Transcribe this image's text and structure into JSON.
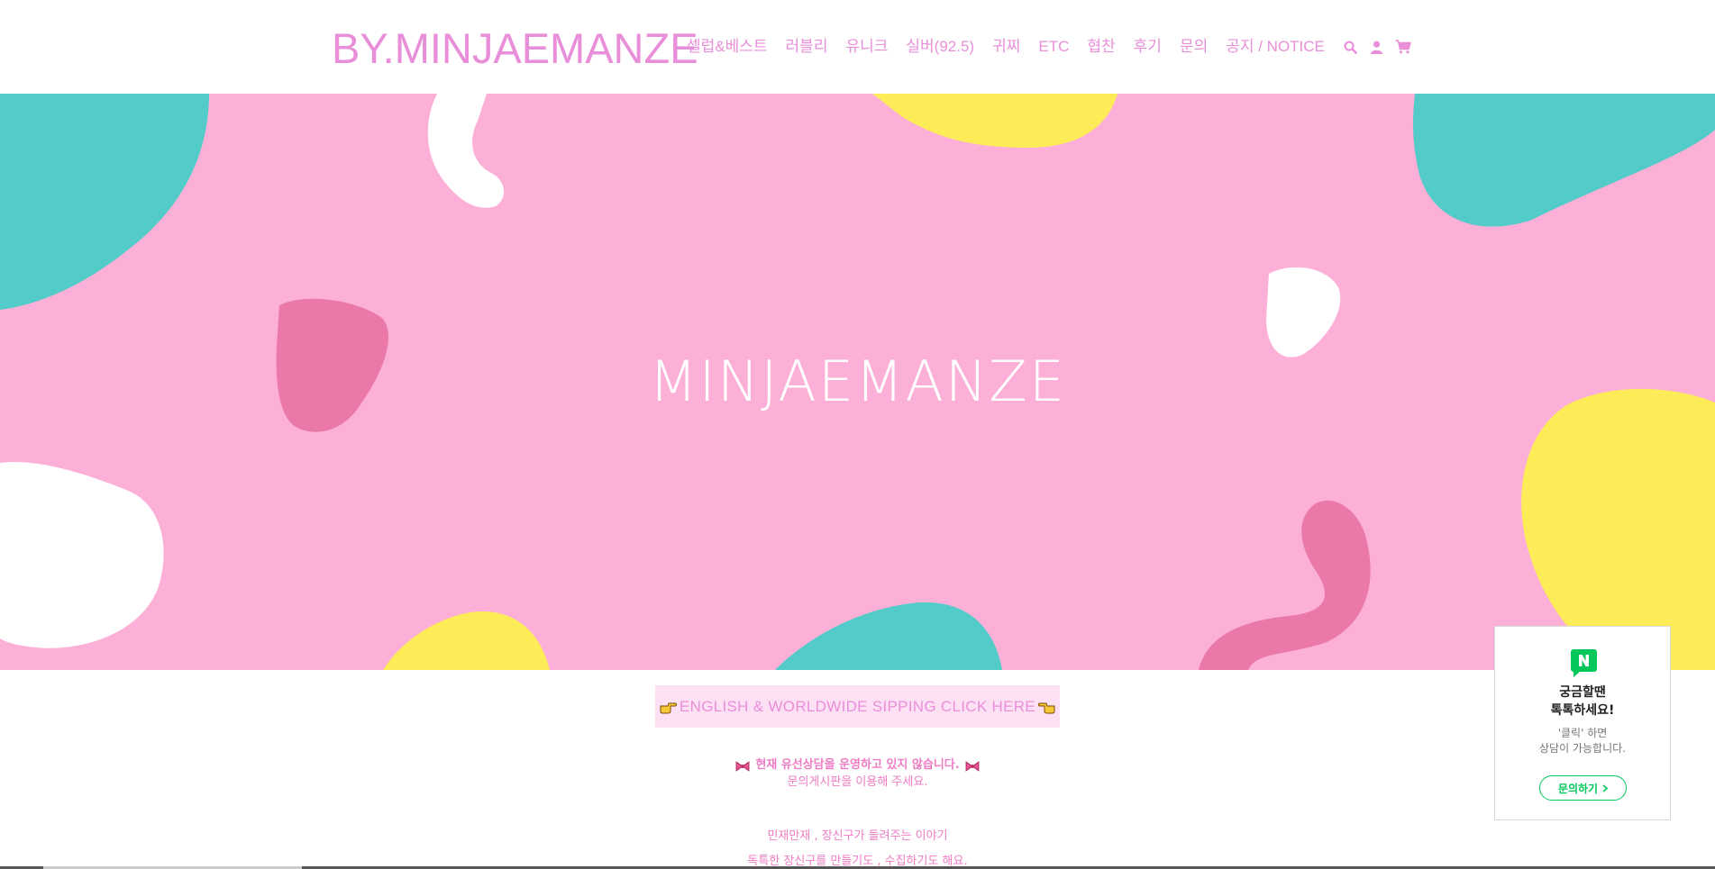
{
  "header": {
    "logo": "BY.MINJAEMANZE",
    "nav": [
      {
        "label": "셀럽&베스트"
      },
      {
        "label": "러블리"
      },
      {
        "label": "유니크"
      },
      {
        "label": "실버(92.5)"
      },
      {
        "label": "귀찌"
      },
      {
        "label": "ETC"
      },
      {
        "label": "협찬"
      },
      {
        "label": "후기"
      },
      {
        "label": "문의"
      },
      {
        "label": "공지 / NOTICE"
      }
    ],
    "icons": [
      "search-icon",
      "user-icon",
      "cart-icon"
    ]
  },
  "hero": {
    "title": "MINJAEMANZE"
  },
  "english_banner": {
    "label": "ENGLISH & WORLDWIDE SIPPING CLICK HERE"
  },
  "notice": {
    "line1": "현재 유선상담을 운영하고 있지 않습니다.",
    "line2": "문의게시판을 이용해 주세요."
  },
  "story": {
    "line1": "민재만재 , 장신구가 들려주는 이야기",
    "line2": "독특한 장신구를 만들기도 , 수집하기도 해요."
  },
  "talk_widget": {
    "title_line1": "궁금할땐",
    "title_line2": "톡톡하세요!",
    "sub_line1": "'클릭' 하면",
    "sub_line2": "상담이 가능합니다.",
    "button": "문의하기"
  },
  "colors": {
    "brand_pink": "#e98fd9",
    "hero_bg": "#fcb0d7",
    "teal": "#53cbc9",
    "yellow": "#fdec58",
    "deep_pink": "#ea78a8",
    "naver_green": "#03c75a"
  }
}
